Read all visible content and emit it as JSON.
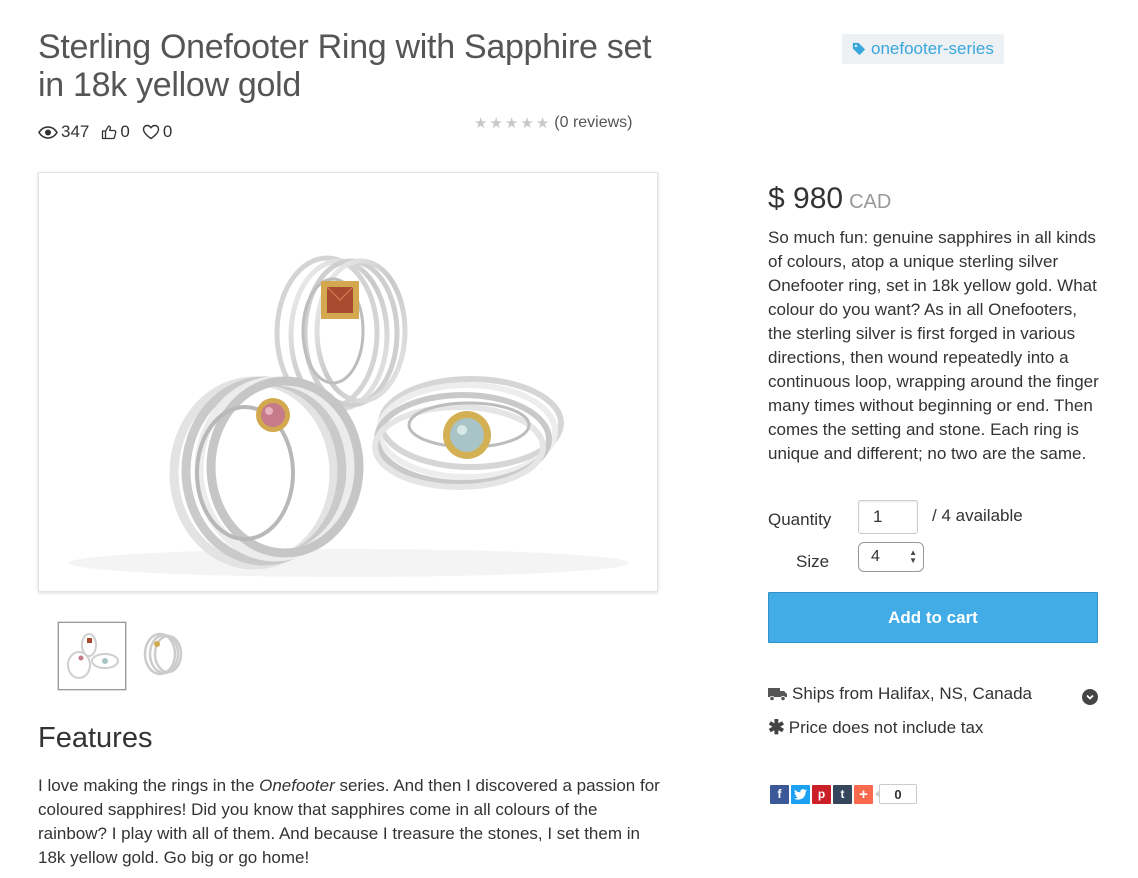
{
  "product": {
    "title": "Sterling Onefooter Ring with Sapphire set in 18k yellow gold",
    "tag": "onefooter-series",
    "views": "347",
    "likes": "0",
    "favorites": "0",
    "rating_stars": 0,
    "reviews": "(0 reviews)"
  },
  "pricing": {
    "amount": "$ 980",
    "currency": "CAD",
    "description": "So much fun: genuine sapphires in all kinds of colours, atop a unique sterling silver Onefooter ring, set in 18k yellow gold. What colour do you want? As in all Onefooters, the sterling silver is first forged in various directions, then wound repeatedly into a continuous loop, wrapping around the finger many times without beginning or end. Then comes the setting and stone. Each ring is unique and different; no two are the same."
  },
  "purchase": {
    "quantity_label": "Quantity",
    "quantity_value": "1",
    "available": "/ 4 available",
    "size_label": "Size",
    "size_value": "4",
    "add_to_cart": "Add to cart"
  },
  "shipping": {
    "ships_from": "Ships from Halifax, NS, Canada",
    "tax_note": "Price does not include tax"
  },
  "features": {
    "heading": "Features",
    "text_before": "I love making the rings in the ",
    "text_italic": "Onefooter",
    "text_after": " series. And then I discovered a passion for coloured sapphires! Did you know that sapphires come in all colours of the rainbow? I play with all of them. And because I treasure the stones, I set them in 18k yellow gold. Go big or go home!"
  },
  "share": {
    "count": "0",
    "buttons": [
      "f",
      "t",
      "p",
      "t",
      "+"
    ]
  },
  "colors": {
    "accent": "#41ace5",
    "tag_text": "#39a7dd",
    "tag_bg": "#eef1f3",
    "facebook": "#3b5998",
    "twitter": "#1da1f2",
    "pinterest": "#cb2027",
    "tumblr": "#35465c",
    "addthis": "#f8694d"
  }
}
